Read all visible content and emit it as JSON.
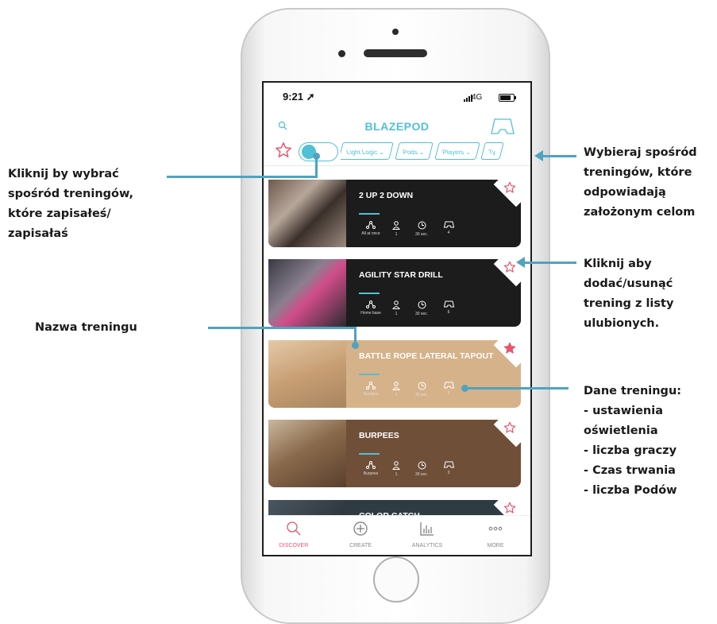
{
  "annotations": {
    "saved": "Kliknij by wybrać\nspośród treningów,\nktóre zapisałeś/\nzapisałaś",
    "filters": "Wybieraj spośród\ntreningów, które\nodpowiadają\nzałożonym celom",
    "favorite": "Kliknij aby\ndodać/usunąć\ntrening z listy\nulubionych.",
    "name": "Nazwa treningu",
    "data": "Dane treningu:\n- ustawienia\n  oświetlenia\n- liczba graczy\n- Czas trwania\n- liczba Podów"
  },
  "status": {
    "time": "9:21",
    "network": "4G"
  },
  "app": {
    "title": "BLAZEPOD"
  },
  "filters": [
    "Light Logic",
    "Pods",
    "Players",
    "Ty"
  ],
  "trainings": [
    {
      "title": "2 UP 2 DOWN",
      "favorite": false,
      "color": "#1c1c1c",
      "photo": "gym",
      "stats": [
        "All at once",
        "1",
        "30 sec.",
        "4"
      ]
    },
    {
      "title": "AGILITY STAR DRILL",
      "favorite": false,
      "color": "#1c1c1c",
      "photo": "agility",
      "stats": [
        "Home base",
        "1",
        "30 sec.",
        "6"
      ]
    },
    {
      "title": "BATTLE ROPE LATERAL TAPOUT",
      "favorite": true,
      "color": "#d6b28a",
      "photo": "rope",
      "stats": [
        "Random",
        "1",
        "30 sec.",
        "2"
      ]
    },
    {
      "title": "BURPEES",
      "favorite": false,
      "color": "#6f4f38",
      "photo": "burpee",
      "stats": [
        "Burpees",
        "1",
        "30 sec.",
        "3"
      ]
    },
    {
      "title": "COLOR CATCH",
      "favorite": false,
      "color": "#2e3b43",
      "photo": "color",
      "stats": []
    }
  ],
  "nav": [
    {
      "label": "DISCOVER",
      "icon": "discover-icon",
      "active": true
    },
    {
      "label": "CREATE",
      "icon": "create-icon",
      "active": false
    },
    {
      "label": "ANALYTICS",
      "icon": "analytics-icon",
      "active": false
    },
    {
      "label": "MORE",
      "icon": "more-icon",
      "active": false
    }
  ],
  "colors": {
    "accent": "#4fc0d8",
    "favorite": "#e8546e",
    "annotation": "#4fa3c0"
  }
}
